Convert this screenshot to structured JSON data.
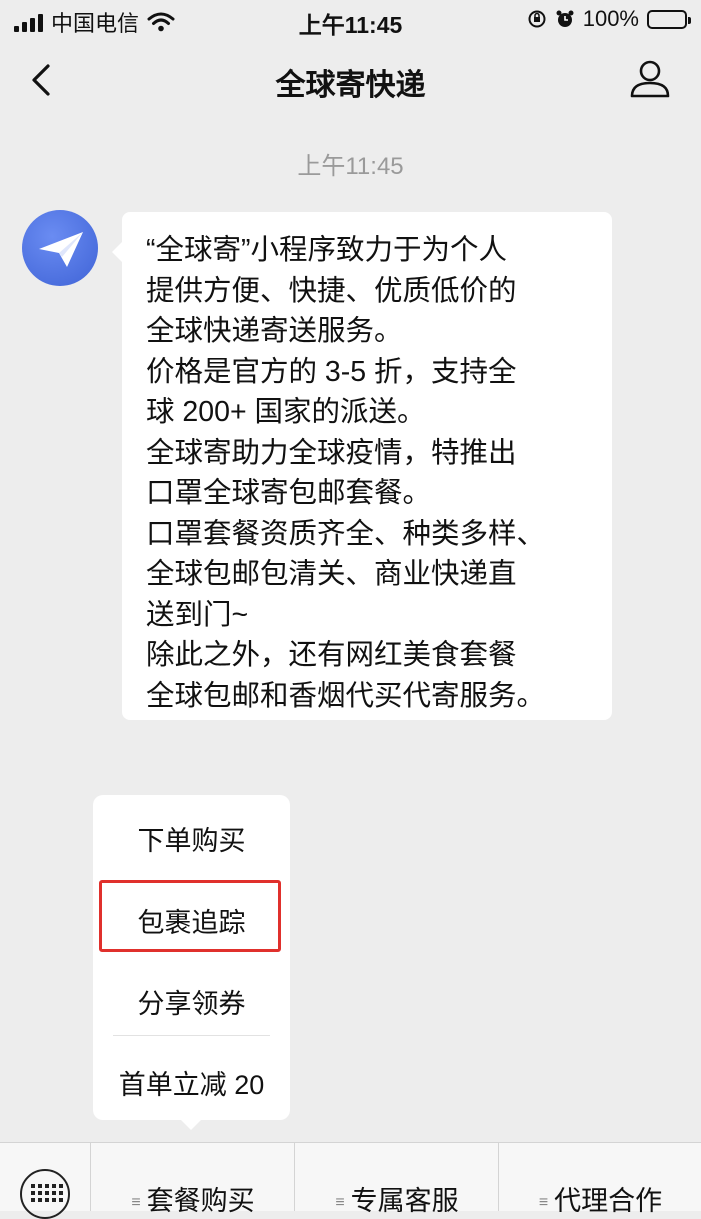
{
  "status_bar": {
    "carrier": "中国电信",
    "time": "上午11:45",
    "battery": "100%"
  },
  "nav": {
    "title": "全球寄快递"
  },
  "chat": {
    "timestamp": "上午11:45",
    "message_lines": [
      "“全球寄”小程序致力于为个人",
      "提供方便、快捷、优质低价的",
      "全球快递寄送服务。",
      "价格是官方的 3-5 折，支持全",
      "球 200+ 国家的派送。",
      "全球寄助力全球疫情，特推出",
      "口罩全球寄包邮套餐。",
      "口罩套餐资质齐全、种类多样、",
      "全球包邮包清关、商业快递直",
      "送到门~",
      "除此之外，还有网红美食套餐",
      "全球包邮和香烟代买代寄服务。"
    ]
  },
  "popup_menu": {
    "items": [
      "下单购买",
      "包裹追踪",
      "分享领券",
      "首单立减 20"
    ],
    "highlighted": "包裹追踪",
    "highlight_color": "#e0302c"
  },
  "bottom_menu": {
    "items": [
      "套餐购买",
      "专属客服",
      "代理合作"
    ]
  },
  "colors": {
    "background": "#ededed",
    "avatar_blue": "#4a6fe0",
    "bubble": "#ffffff"
  }
}
